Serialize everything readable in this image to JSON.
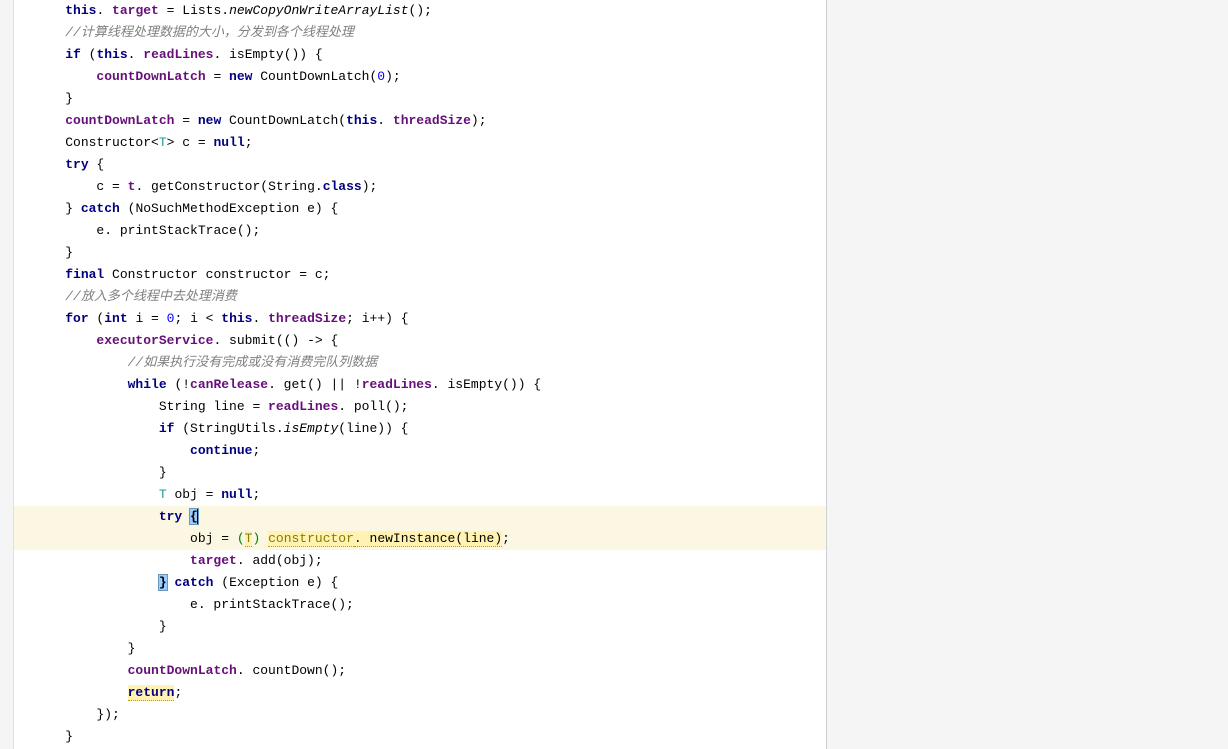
{
  "lines": [
    {
      "indent": 1,
      "segments": [
        {
          "t": "this",
          "c": "kw"
        },
        {
          "t": ". "
        },
        {
          "t": "target",
          "c": "purple"
        },
        {
          "t": " = Lists."
        },
        {
          "t": "newCopyOnWriteArrayList",
          "c": "italic"
        },
        {
          "t": "();"
        }
      ]
    },
    {
      "indent": 1,
      "segments": [
        {
          "t": "//计算线程处理数据的大小，分发到各个线程处理",
          "c": "comment"
        }
      ]
    },
    {
      "indent": 1,
      "segments": [
        {
          "t": "if",
          "c": "kw"
        },
        {
          "t": " ("
        },
        {
          "t": "this",
          "c": "kw"
        },
        {
          "t": ". "
        },
        {
          "t": "readLines",
          "c": "purple"
        },
        {
          "t": ". isEmpty()) {"
        }
      ]
    },
    {
      "indent": 2,
      "segments": [
        {
          "t": "countDownLatch",
          "c": "purple"
        },
        {
          "t": " = "
        },
        {
          "t": "new",
          "c": "kw"
        },
        {
          "t": " CountDownLatch("
        },
        {
          "t": "0",
          "c": "num"
        },
        {
          "t": ");"
        }
      ]
    },
    {
      "indent": 1,
      "segments": [
        {
          "t": "}"
        }
      ]
    },
    {
      "indent": 1,
      "segments": [
        {
          "t": "countDownLatch",
          "c": "purple"
        },
        {
          "t": " = "
        },
        {
          "t": "new",
          "c": "kw"
        },
        {
          "t": " CountDownLatch("
        },
        {
          "t": "this",
          "c": "kw"
        },
        {
          "t": ". "
        },
        {
          "t": "threadSize",
          "c": "purple"
        },
        {
          "t": ");"
        }
      ]
    },
    {
      "indent": 1,
      "segments": [
        {
          "t": "Constructor<"
        },
        {
          "t": "T",
          "c": "gen"
        },
        {
          "t": "> c = "
        },
        {
          "t": "null",
          "c": "kw"
        },
        {
          "t": ";"
        }
      ]
    },
    {
      "indent": 1,
      "segments": [
        {
          "t": "try",
          "c": "kw"
        },
        {
          "t": " {"
        }
      ]
    },
    {
      "indent": 2,
      "segments": [
        {
          "t": "c = "
        },
        {
          "t": "t",
          "c": "purple"
        },
        {
          "t": ". getConstructor(String."
        },
        {
          "t": "class",
          "c": "kw"
        },
        {
          "t": ");"
        }
      ]
    },
    {
      "indent": 1,
      "segments": [
        {
          "t": "} "
        },
        {
          "t": "catch",
          "c": "kw"
        },
        {
          "t": " (NoSuchMethodException e) {"
        }
      ]
    },
    {
      "indent": 2,
      "segments": [
        {
          "t": "e. printStackTrace();"
        }
      ]
    },
    {
      "indent": 1,
      "segments": [
        {
          "t": "}"
        }
      ]
    },
    {
      "indent": 1,
      "segments": [
        {
          "t": "final",
          "c": "kw"
        },
        {
          "t": " Constructor constructor = c;"
        }
      ]
    },
    {
      "indent": 1,
      "segments": [
        {
          "t": "//放入多个线程中去处理消费",
          "c": "comment"
        }
      ]
    },
    {
      "indent": 1,
      "segments": [
        {
          "t": "for",
          "c": "kw"
        },
        {
          "t": " ("
        },
        {
          "t": "int",
          "c": "kw"
        },
        {
          "t": " i = "
        },
        {
          "t": "0",
          "c": "num"
        },
        {
          "t": "; i < "
        },
        {
          "t": "this",
          "c": "kw"
        },
        {
          "t": ". "
        },
        {
          "t": "threadSize",
          "c": "purple"
        },
        {
          "t": "; i++) {"
        }
      ]
    },
    {
      "indent": 2,
      "segments": [
        {
          "t": "executorService",
          "c": "purple"
        },
        {
          "t": ". submit(() -> {"
        }
      ]
    },
    {
      "indent": 3,
      "segments": [
        {
          "t": "//如果执行没有完成或没有消费完队列数据",
          "c": "comment"
        }
      ]
    },
    {
      "indent": 3,
      "segments": [
        {
          "t": "while",
          "c": "kw"
        },
        {
          "t": " (!"
        },
        {
          "t": "canRelease",
          "c": "purple"
        },
        {
          "t": ". get() || !"
        },
        {
          "t": "readLines",
          "c": "purple"
        },
        {
          "t": ". isEmpty()) {"
        }
      ]
    },
    {
      "indent": 4,
      "segments": [
        {
          "t": "String line = "
        },
        {
          "t": "readLines",
          "c": "purple"
        },
        {
          "t": ". poll();"
        }
      ]
    },
    {
      "indent": 4,
      "segments": [
        {
          "t": "if",
          "c": "kw"
        },
        {
          "t": " (StringUtils."
        },
        {
          "t": "isEmpty",
          "c": "italic"
        },
        {
          "t": "(line)) {"
        }
      ]
    },
    {
      "indent": 5,
      "segments": [
        {
          "t": "continue",
          "c": "kw"
        },
        {
          "t": ";"
        }
      ]
    },
    {
      "indent": 4,
      "segments": [
        {
          "t": "}"
        }
      ]
    },
    {
      "indent": 4,
      "segments": [
        {
          "t": "T",
          "c": "gen"
        },
        {
          "t": " obj = "
        },
        {
          "t": "null",
          "c": "kw"
        },
        {
          "t": ";"
        }
      ]
    },
    {
      "indent": 4,
      "hl": "yellow",
      "segments": [
        {
          "t": "try",
          "c": "kw"
        },
        {
          "t": " "
        },
        {
          "t": "{",
          "c": "bracket-match"
        },
        {
          "t": "",
          "c": "cursor"
        }
      ]
    },
    {
      "indent": 5,
      "hl": "yellow",
      "segments": [
        {
          "t": "obj = "
        },
        {
          "t": "(",
          "c": "green"
        },
        {
          "t": "T",
          "c": "olive warn"
        },
        {
          "t": ")",
          "c": "green"
        },
        {
          "t": " "
        },
        {
          "t": "constructor",
          "c": "olive warn"
        },
        {
          "t": ". newInstance(line)",
          "c": "warn"
        },
        {
          "t": ";"
        }
      ]
    },
    {
      "indent": 5,
      "segments": [
        {
          "t": "target",
          "c": "purple"
        },
        {
          "t": ". add(obj);"
        }
      ]
    },
    {
      "indent": 4,
      "segments": [
        {
          "t": "}",
          "c": "bracket-match"
        },
        {
          "t": " "
        },
        {
          "t": "catch",
          "c": "kw"
        },
        {
          "t": " (Exception e) {"
        }
      ]
    },
    {
      "indent": 5,
      "segments": [
        {
          "t": "e. printStackTrace();"
        }
      ]
    },
    {
      "indent": 4,
      "segments": [
        {
          "t": "}"
        }
      ]
    },
    {
      "indent": 3,
      "segments": [
        {
          "t": "}"
        }
      ]
    },
    {
      "indent": 3,
      "segments": [
        {
          "t": "countDownLatch",
          "c": "purple"
        },
        {
          "t": ". countDown();"
        }
      ]
    },
    {
      "indent": 3,
      "segments": [
        {
          "t": "return",
          "c": "kw warn"
        },
        {
          "t": ";"
        }
      ]
    },
    {
      "indent": 2,
      "segments": [
        {
          "t": "});"
        }
      ]
    },
    {
      "indent": 1,
      "segments": [
        {
          "t": "}"
        }
      ]
    }
  ],
  "indentUnit": "    "
}
